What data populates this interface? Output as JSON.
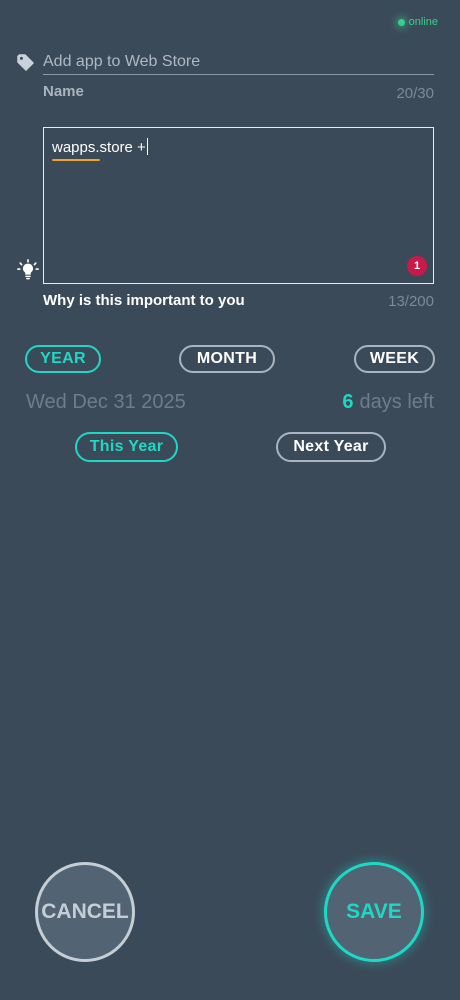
{
  "status": {
    "label": "online",
    "color": "#35d08a"
  },
  "name_field": {
    "placeholder": "Add app to Web Store",
    "label": "Name",
    "counter": "20/30"
  },
  "why_field": {
    "value": "wapps.store +",
    "label": "Why is this important to you",
    "counter": "13/200",
    "error_count": "1"
  },
  "period_tabs": {
    "year": "YEAR",
    "month": "MONTH",
    "week": "WEEK",
    "selected": "YEAR"
  },
  "deadline": {
    "date": "Wed Dec 31 2025",
    "days_number": "6",
    "days_suffix": "days left"
  },
  "year_options": {
    "this_year": "This Year",
    "next_year": "Next Year",
    "selected": "This Year"
  },
  "actions": {
    "cancel": "CANCEL",
    "save": "SAVE"
  },
  "colors": {
    "background": "#3b4a59",
    "accent": "#1ed8c6",
    "error": "#c9184a",
    "spell_underline": "#f0a426"
  },
  "icons": {
    "tag": "tag-icon",
    "bulb": "lightbulb-icon"
  }
}
